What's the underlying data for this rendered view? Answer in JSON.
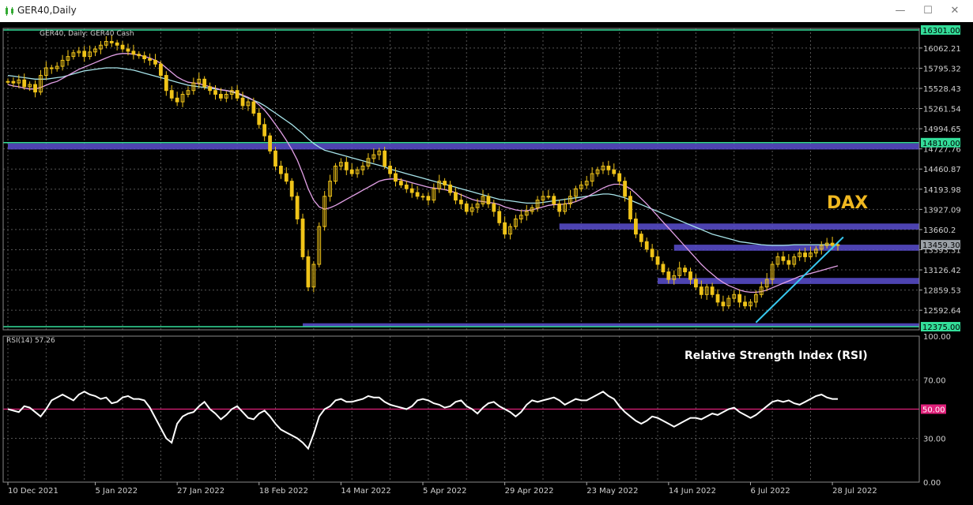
{
  "window": {
    "title": "GER40,Daily",
    "buttons": [
      "minimize",
      "maximize",
      "close"
    ]
  },
  "chart_data": [
    {
      "type": "candlestick",
      "symbol_label": "GER40, Daily:  GER40 Cash",
      "annotation": "DAX",
      "y_range": [
        12375,
        16301
      ],
      "y_ticks": [
        16062.21,
        15795.32,
        15528.43,
        15261.54,
        14994.65,
        14727.76,
        14460.87,
        14193.98,
        13927.09,
        13660.2,
        13393.31,
        13126.42,
        12859.53,
        12592.64
      ],
      "price_tags": [
        {
          "label": "16301.00",
          "value": 16301.0,
          "color": "#33dd99"
        },
        {
          "label": "14810.00",
          "value": 14810.0,
          "color": "#33dd99"
        },
        {
          "label": "13459.30",
          "value": 13459.3,
          "color": "#9aa0a6"
        },
        {
          "label": "12375.00",
          "value": 12375.0,
          "color": "#33dd99"
        }
      ],
      "x_labels": [
        "10 Dec 2021",
        "5 Jan 2022",
        "27 Jan 2022",
        "18 Feb 2022",
        "14 Mar 2022",
        "5 Apr 2022",
        "29 Apr 2022",
        "23 May 2022",
        "14 Jun 2022",
        "6 Jul 2022",
        "28 Jul 2022"
      ],
      "horizontal_lines": [
        {
          "value": 16301,
          "color": "#33dd99"
        },
        {
          "value": 14810,
          "color": "#33dd99"
        },
        {
          "value": 12375,
          "color": "#33dd99"
        }
      ],
      "zones": [
        {
          "from_bar": 0,
          "low": 14720,
          "high": 14800,
          "color": "#5a4fd0"
        },
        {
          "from_bar": 101,
          "low": 13660,
          "high": 13740,
          "color": "#5a4fd0"
        },
        {
          "from_bar": 122,
          "low": 13380,
          "high": 13460,
          "color": "#5a4fd0"
        },
        {
          "from_bar": 119,
          "low": 12940,
          "high": 13020,
          "color": "#5a4fd0"
        },
        {
          "from_bar": 54,
          "low": 12380,
          "high": 12420,
          "color": "#5a4fd0"
        }
      ],
      "trendline": {
        "from": [
          137,
          12430
        ],
        "to": [
          153,
          13560
        ],
        "color": "#38c9f0"
      },
      "close": [
        15620,
        15600,
        15640,
        15550,
        15580,
        15480,
        15700,
        15800,
        15790,
        15820,
        15900,
        15950,
        16000,
        16020,
        15950,
        16010,
        16050,
        16100,
        16150,
        16130,
        16100,
        16050,
        16020,
        15980,
        15960,
        15920,
        15900,
        15850,
        15700,
        15500,
        15400,
        15350,
        15450,
        15500,
        15600,
        15650,
        15550,
        15500,
        15450,
        15400,
        15450,
        15500,
        15400,
        15300,
        15350,
        15200,
        15050,
        14900,
        14700,
        14500,
        14400,
        14300,
        14100,
        13800,
        13300,
        12900,
        13200,
        13700,
        14100,
        14300,
        14500,
        14550,
        14450,
        14400,
        14450,
        14500,
        14600,
        14650,
        14700,
        14500,
        14400,
        14300,
        14250,
        14200,
        14150,
        14100,
        14100,
        14050,
        14200,
        14300,
        14250,
        14150,
        14050,
        14000,
        13900,
        13950,
        14000,
        14100,
        14000,
        13900,
        13750,
        13600,
        13700,
        13800,
        13850,
        13900,
        13950,
        14050,
        14100,
        14100,
        14000,
        13900,
        14000,
        14100,
        14200,
        14250,
        14300,
        14400,
        14450,
        14500,
        14450,
        14400,
        14300,
        14100,
        13800,
        13600,
        13500,
        13400,
        13300,
        13200,
        13100,
        13000,
        13050,
        13150,
        13100,
        13000,
        12900,
        12800,
        12900,
        12800,
        12700,
        12650,
        12750,
        12800,
        12700,
        12650,
        12700,
        12800,
        12900,
        13000,
        13200,
        13300,
        13250,
        13200,
        13300,
        13350,
        13300,
        13350,
        13400,
        13450,
        13480,
        13450,
        13460
      ],
      "ma_fast": [
        15580,
        15560,
        15550,
        15530,
        15520,
        15520,
        15540,
        15570,
        15600,
        15620,
        15660,
        15700,
        15740,
        15780,
        15810,
        15840,
        15870,
        15900,
        15930,
        15960,
        15980,
        15990,
        15990,
        15980,
        15970,
        15950,
        15930,
        15900,
        15860,
        15800,
        15740,
        15680,
        15640,
        15610,
        15600,
        15590,
        15570,
        15550,
        15530,
        15510,
        15500,
        15490,
        15470,
        15440,
        15410,
        15370,
        15310,
        15240,
        15150,
        15050,
        14950,
        14840,
        14720,
        14580,
        14400,
        14200,
        14050,
        13960,
        13930,
        13950,
        13980,
        14020,
        14060,
        14100,
        14140,
        14180,
        14220,
        14260,
        14300,
        14320,
        14330,
        14330,
        14320,
        14300,
        14280,
        14260,
        14240,
        14220,
        14210,
        14200,
        14190,
        14170,
        14150,
        14120,
        14090,
        14060,
        14040,
        14030,
        14020,
        14010,
        13990,
        13960,
        13940,
        13920,
        13910,
        13910,
        13920,
        13940,
        13960,
        13980,
        13990,
        13990,
        14000,
        14010,
        14030,
        14060,
        14090,
        14130,
        14170,
        14210,
        14240,
        14260,
        14260,
        14240,
        14200,
        14140,
        14070,
        14000,
        13920,
        13840,
        13760,
        13680,
        13600,
        13520,
        13440,
        13360,
        13280,
        13200,
        13130,
        13070,
        13010,
        12960,
        12920,
        12890,
        12860,
        12840,
        12830,
        12830,
        12840,
        12860,
        12890,
        12920,
        12950,
        12980,
        13010,
        13040,
        13060,
        13080,
        13100,
        13120,
        13140,
        13160,
        13180
      ],
      "ma_slow": [
        15700,
        15690,
        15680,
        15670,
        15660,
        15650,
        15650,
        15650,
        15660,
        15670,
        15680,
        15700,
        15720,
        15740,
        15760,
        15770,
        15780,
        15790,
        15800,
        15800,
        15800,
        15790,
        15780,
        15770,
        15750,
        15730,
        15710,
        15690,
        15670,
        15650,
        15630,
        15610,
        15590,
        15570,
        15560,
        15550,
        15540,
        15530,
        15520,
        15510,
        15500,
        15480,
        15460,
        15430,
        15400,
        15370,
        15340,
        15300,
        15250,
        15200,
        15150,
        15100,
        15050,
        14990,
        14930,
        14860,
        14800,
        14750,
        14710,
        14690,
        14670,
        14650,
        14630,
        14610,
        14590,
        14570,
        14550,
        14530,
        14510,
        14490,
        14460,
        14440,
        14420,
        14400,
        14380,
        14360,
        14340,
        14320,
        14300,
        14280,
        14260,
        14240,
        14220,
        14200,
        14180,
        14160,
        14140,
        14120,
        14100,
        14080,
        14060,
        14050,
        14040,
        14030,
        14020,
        14010,
        14010,
        14010,
        14020,
        14030,
        14040,
        14050,
        14060,
        14070,
        14080,
        14090,
        14100,
        14110,
        14120,
        14130,
        14130,
        14120,
        14100,
        14080,
        14050,
        14020,
        13990,
        13960,
        13930,
        13900,
        13870,
        13840,
        13810,
        13780,
        13750,
        13720,
        13690,
        13660,
        13630,
        13600,
        13580,
        13560,
        13540,
        13520,
        13500,
        13490,
        13480,
        13470,
        13460,
        13455,
        13450,
        13450,
        13450,
        13455,
        13460,
        13460,
        13460,
        13460,
        13460,
        13460,
        13460,
        13460,
        13460
      ],
      "colors": {
        "background": "#000000",
        "candle": "#f0c419",
        "ma_fast": "#e2a0e6",
        "ma_slow": "#a7e4ea",
        "grid": "#555555",
        "text": "#d0d0d0",
        "annotation": "#f0b820"
      }
    },
    {
      "type": "line",
      "label": "RSI(14) 57.26",
      "annotation": "Relative Strength Index (RSI)",
      "y_range": [
        0,
        100
      ],
      "y_ticks": [
        100.0,
        70.0,
        30.0,
        0.0
      ],
      "y_tick_labels": [
        "100.00",
        "70.00",
        "30.00",
        "0.00"
      ],
      "level": {
        "value": 50,
        "label": "50.00",
        "color": "#e0207a"
      },
      "series": [
        {
          "values": [
            50,
            49,
            48,
            52,
            51,
            48,
            45,
            50,
            56,
            58,
            60,
            58,
            56,
            60,
            62,
            60,
            59,
            57,
            58,
            54,
            55,
            58,
            59,
            57,
            57,
            56,
            51,
            44,
            37,
            30,
            27,
            40,
            45,
            47,
            48,
            52,
            55,
            50,
            47,
            43,
            46,
            50,
            52,
            48,
            44,
            43,
            47,
            49,
            45,
            40,
            36,
            34,
            32,
            30,
            27,
            23,
            33,
            45,
            50,
            52,
            56,
            57,
            55,
            55,
            56,
            57,
            59,
            58,
            58,
            55,
            53,
            52,
            51,
            50,
            52,
            56,
            57,
            56,
            54,
            53,
            51,
            52,
            55,
            56,
            52,
            50,
            47,
            51,
            54,
            55,
            52,
            50,
            48,
            45,
            48,
            53,
            56,
            55,
            56,
            57,
            58,
            56,
            53,
            55,
            57,
            56,
            56,
            58,
            60,
            62,
            59,
            57,
            52,
            48,
            45,
            42,
            40,
            42,
            45,
            44,
            42,
            40,
            38,
            40,
            42,
            44,
            44,
            43,
            45,
            47,
            46,
            48,
            50,
            51,
            48,
            46,
            44,
            46,
            49,
            52,
            55,
            56,
            55,
            56,
            54,
            53,
            55,
            57,
            59,
            60,
            58,
            57,
            57
          ]
        }
      ],
      "colors": {
        "line": "#ffffff",
        "background": "#000000"
      }
    }
  ]
}
